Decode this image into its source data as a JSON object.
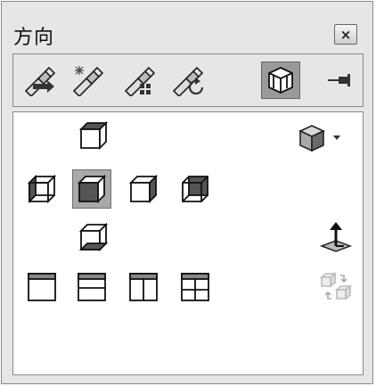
{
  "window": {
    "title": "方向",
    "close_label": "×"
  },
  "toolbar": {
    "buttons": [
      {
        "name": "view-previous",
        "icon": "flashlight-arrow-icon"
      },
      {
        "name": "view-new",
        "icon": "flashlight-spark-icon"
      },
      {
        "name": "view-selection",
        "icon": "flashlight-grid-icon"
      },
      {
        "name": "view-reset",
        "icon": "flashlight-reset-icon"
      },
      {
        "name": "view-cube-toggle",
        "icon": "cube-3d-icon",
        "active": true
      },
      {
        "name": "pin",
        "icon": "pin-icon"
      }
    ]
  },
  "views": {
    "top": "cube-top-face-icon",
    "left": "cube-left-face-icon",
    "front": "cube-front-face-icon",
    "right": "cube-right-face-icon",
    "back": "cube-back-face-icon",
    "bottom": "cube-bottom-face-icon",
    "isometric_menu": "isometric-cube-dropdown-icon",
    "normal_to": "normal-to-arrow-icon",
    "link_views": "link-views-icon"
  },
  "layouts": [
    "single-view-icon",
    "two-view-horizontal-icon",
    "two-view-vertical-icon",
    "four-view-icon"
  ],
  "colors": {
    "panel": "#e6e6e6",
    "selected": "#a9a9a9",
    "view_bg": "#ffffff"
  }
}
